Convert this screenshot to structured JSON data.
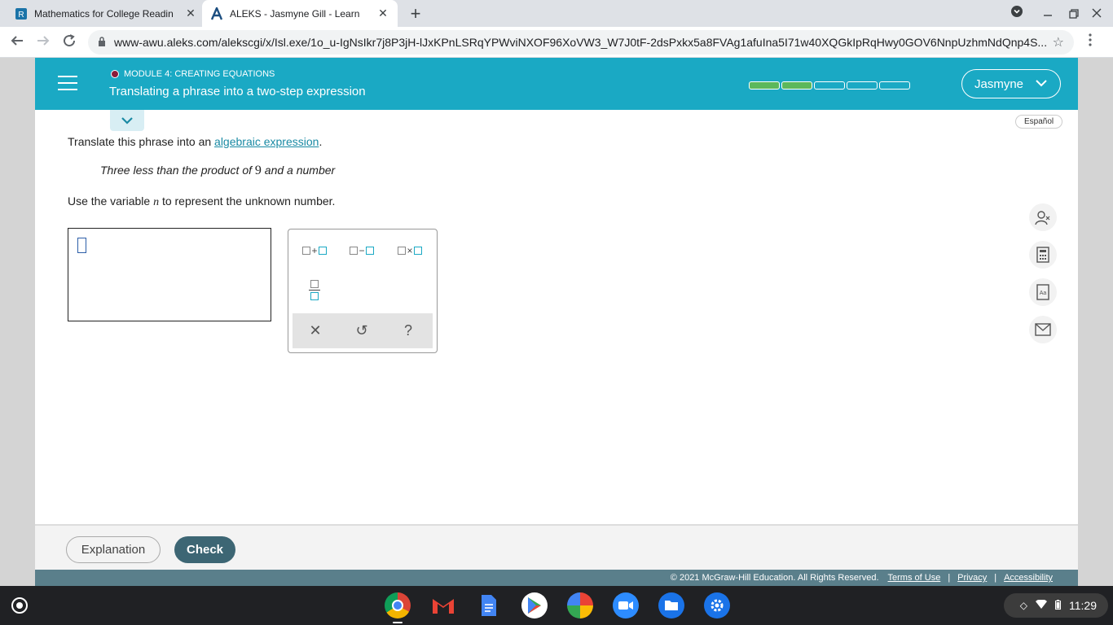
{
  "browser": {
    "tabs": [
      {
        "title": "Mathematics for College Readin",
        "close": "✕"
      },
      {
        "title": "ALEKS - Jasmyne Gill - Learn",
        "close": "✕"
      }
    ],
    "new_tab": "+",
    "url": "www-awu.aleks.com/alekscgi/x/Isl.exe/1o_u-IgNsIkr7j8P3jH-lJxKPnLSRqYPWviNXOF96XoVW3_W7J0tF-2dsPxkx5a8FVAg1afuIna5I71w40XQGkIpRqHwy0GOV6NnpUzhmNdQnp4S..."
  },
  "header": {
    "module": "MODULE 4: CREATING EQUATIONS",
    "topic": "Translating a phrase into a two-step expression",
    "progress_filled": 2,
    "progress_total": 5,
    "user": "Jasmyne"
  },
  "language_link": "Español",
  "question": {
    "line1_pre": "Translate this phrase into an ",
    "line1_link": "algebraic expression",
    "line1_post": ".",
    "phrase_pre": "Three less than the product of ",
    "phrase_num": "9",
    "phrase_post": " and a number",
    "line2_pre": "Use the variable ",
    "line2_var": "n",
    "line2_post": " to represent the unknown number."
  },
  "keypad": {
    "plus": "+",
    "minus": "−",
    "times": "×",
    "clear": "✕",
    "undo": "↺",
    "help": "?"
  },
  "footer": {
    "explanation": "Explanation",
    "check": "Check",
    "copyright": "© 2021 McGraw-Hill Education. All Rights Reserved.",
    "links": [
      "Terms of Use",
      "Privacy",
      "Accessibility"
    ],
    "separator": "|"
  },
  "shelf": {
    "time": "11:29"
  },
  "colors": {
    "header": "#1aa9c4",
    "progress_fill": "#5cb85c",
    "check_button": "#3d6674",
    "footer_bar": "#5a7f8b"
  }
}
